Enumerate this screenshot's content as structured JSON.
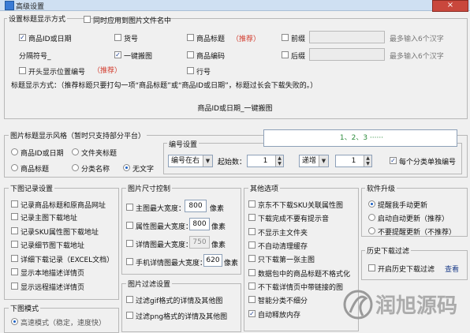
{
  "window": {
    "title": "高级设置",
    "close_glyph": "×"
  },
  "title_display": {
    "group_label": "设置标题显示方式",
    "also_apply": {
      "label": "同时应用到图片文件名中",
      "checked": false
    },
    "options": {
      "product_id_date": {
        "label": "商品ID或日期",
        "checked": true
      },
      "item_no": {
        "label": "货号",
        "checked": false
      },
      "product_title": {
        "label": "商品标题",
        "checked": false
      },
      "product_title_tag": "（推荐）",
      "prefix": {
        "label": "前缀",
        "checked": false,
        "value": ""
      },
      "prefix_hint": "最多输入6个汉字",
      "separator_label": "分隔符号_",
      "one_click_image": {
        "label": "一键搬图",
        "checked": true
      },
      "product_code": {
        "label": "商品编码",
        "checked": false
      },
      "suffix": {
        "label": "后缀",
        "checked": false,
        "value": ""
      },
      "suffix_hint": "最多输入6个汉字",
      "prefix_position_no": {
        "label": "开头显示位置编号",
        "checked": false
      },
      "prefix_position_tag": "（推荐）",
      "row_no": {
        "label": "行号",
        "checked": false
      }
    },
    "format_note": "标题显示方式：（推荐标题只要打勾一项“商品标题”或“商品ID或日期”，标题过长会下载失败的。）",
    "preview": "商品ID或日期_一键搬图"
  },
  "title_style": {
    "group_label": "图片标题显示风格（暂时只支持部分平台）",
    "radios": [
      {
        "label": "商品ID或日期",
        "on": false
      },
      {
        "label": "文件夹标题",
        "on": false
      },
      {
        "label": "商品标题",
        "on": false
      },
      {
        "label": "分类名称",
        "on": false
      },
      {
        "label": "无文字",
        "on": true
      }
    ],
    "numbering": {
      "group_label": "编号设置",
      "sample": "1、2、3 ······",
      "position": "编号在右",
      "start_label": "起始数：",
      "start_value": "1",
      "order": "递增",
      "step_value": "1",
      "per_category": {
        "label": "每个分类单独编号",
        "checked": true
      }
    }
  },
  "download_record": {
    "group_label": "下图记录设置",
    "items": [
      {
        "label": "记录商品标题和原商品网址",
        "checked": false
      },
      {
        "label": "记录主图下载地址",
        "checked": false
      },
      {
        "label": "记录SKU属性图下载地址",
        "checked": false
      },
      {
        "label": "记录细节图下载地址",
        "checked": false
      },
      {
        "label": "详细下载记录（EXCEL文档）",
        "checked": false
      },
      {
        "label": "显示本地描述详情页",
        "checked": false
      },
      {
        "label": "显示远程描述详情页",
        "checked": false
      }
    ]
  },
  "download_mode": {
    "group_label": "下图模式",
    "partial_text": "高速模式（稳定，速度快）"
  },
  "image_size": {
    "group_label": "图片尺寸控制",
    "rows": [
      {
        "label": "主图最大宽度：",
        "value": "800",
        "unit": "像素",
        "checked": false,
        "disabled": false
      },
      {
        "label": "属性图最大宽度：",
        "value": "800",
        "unit": "像素",
        "checked": false,
        "disabled": false
      },
      {
        "label": "详情图最大宽度：",
        "value": "750",
        "unit": "像素",
        "checked": false,
        "disabled": true
      },
      {
        "label": "手机详情图最大宽度：",
        "value": "620",
        "unit": "像素",
        "checked": false,
        "disabled": false
      }
    ]
  },
  "image_filter": {
    "group_label": "图片过滤设置",
    "items": [
      {
        "label": "过滤gif格式的详情及其他图",
        "checked": false
      },
      {
        "label": "过滤png格式的详情及其他图",
        "checked": false
      }
    ]
  },
  "other": {
    "group_label": "其他选项",
    "items": [
      {
        "label": "京东不下载SKU关联属性图",
        "checked": false
      },
      {
        "label": "下载完成不要有提示音",
        "checked": false
      },
      {
        "label": "不显示主文件夹",
        "checked": false
      },
      {
        "label": "不自动清理缓存",
        "checked": false
      },
      {
        "label": "只下载第一张主图",
        "checked": false
      },
      {
        "label": "数据包中的商品标题不格式化",
        "checked": false
      },
      {
        "label": "不下载详情页中带链接的图",
        "checked": false
      },
      {
        "label": "智能分类不细分",
        "checked": false
      },
      {
        "label": "自动释放内存",
        "checked": true
      }
    ]
  },
  "upgrade": {
    "group_label": "软件升级",
    "radios": [
      {
        "label": "提醒我手动更新",
        "on": true
      },
      {
        "label": "启动自动更新（推荐）",
        "on": false
      },
      {
        "label": "不要提醒更新（不推荐）",
        "on": false
      }
    ]
  },
  "history": {
    "group_label": "历史下载过滤",
    "enable": {
      "label": "开启历史下载过滤",
      "checked": false
    },
    "view_link": "查看"
  },
  "watermark_text": "润旭源码",
  "colors": {
    "accent_red": "#d23a2c",
    "title_bar": "#cfe0f2",
    "check_blue": "#1a3d8f"
  }
}
